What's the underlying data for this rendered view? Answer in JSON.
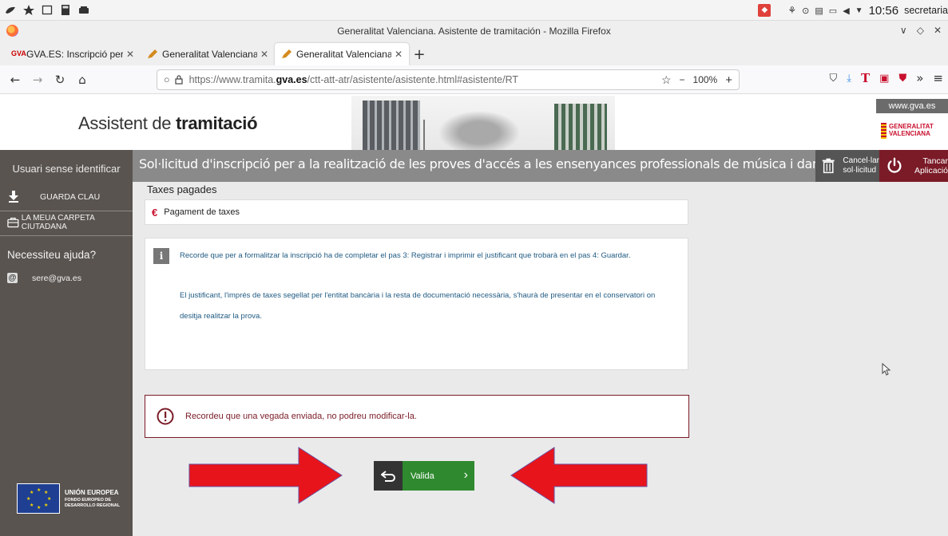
{
  "os": {
    "clock": "10:56",
    "user": "secretaria"
  },
  "browser": {
    "window_title": "Generalitat Valenciana. Asistente de tramitación - Mozilla Firefox",
    "tabs": [
      {
        "label": "GVA.ES: Inscripció per a la",
        "favicon": "GVA",
        "active": false
      },
      {
        "label": "Generalitat Valenciana. Asi",
        "favicon": "pen",
        "active": false
      },
      {
        "label": "Generalitat Valenciana. Asi",
        "favicon": "pen",
        "active": true
      }
    ],
    "new_tab": "+",
    "url": {
      "prefix": "https://www.tramita.",
      "domain": "gva.es",
      "path": "/ctt-att-atr/asistente/asistente.html#asistente/RT"
    },
    "zoom": "100%",
    "zoom_minus": "−",
    "zoom_plus": "+"
  },
  "header": {
    "title_light": "Assistent de ",
    "title_bold": "tramitació",
    "site_link": "www.gva.es",
    "logo_line1": "GENERALITAT",
    "logo_line2": "VALENCIANA"
  },
  "band": {
    "user_status": "Usuari sense identificar",
    "title": "Sol·licitud d'inscripció per a la realització de les proves d'accés a les ensenyances professionals de música i dansa",
    "cancel_line1": "Cancel·lar",
    "cancel_line2": "sol·licitud",
    "close_line1": "Tancar",
    "close_line2": "Aplicació"
  },
  "sidebar": {
    "save_key": "GUARDA CLAU",
    "my_folder": "LA MEUA CARPETA CIUTADANA",
    "help_title": "Necessiteu ajuda?",
    "email": "sere@gva.es",
    "eu_title": "UNIÓN EUROPEA",
    "eu_sub1": "FONDO EUROPEO DE",
    "eu_sub2": "DESARROLLO REGIONAL"
  },
  "main": {
    "section_title": "Taxes pagades",
    "tax_item": "Pagament de taxes",
    "info_p1": "Recorde que per a formalitzar la inscripció ha de completar el pas 3: Registrar i imprimir el justificant que trobarà en el pas 4: Guardar.",
    "info_p2": "El justificant, l'imprés de taxes segellat per l'entitat bancària i la resta de documentació necessària, s'haurà de presentar en el conservatori on",
    "info_p3": "desitja realitzar la prova.",
    "warning": "Recordeu que una vegada enviada, no podreu modificar-la.",
    "validate_label": "Valida"
  },
  "colors": {
    "accent_red": "#7a1b27",
    "validate_green": "#2f8a2f",
    "sidebar_bg": "#595450",
    "band_gray": "#8a8a8a",
    "annotation_arrow": "#e8141b"
  }
}
